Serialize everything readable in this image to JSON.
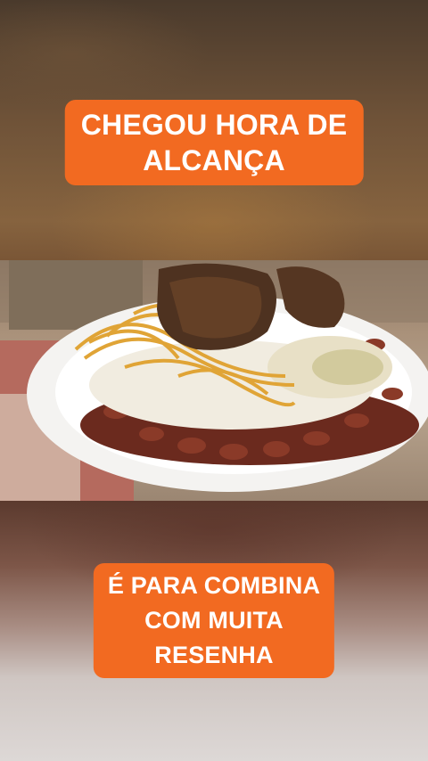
{
  "captions": {
    "top": [
      "CHEGOU HORA DE",
      "ALCANÇA"
    ],
    "bottom": [
      "É PARA COMBINA",
      "COM MUITA",
      "RESENHA"
    ]
  },
  "colors": {
    "caption_bg": "#f26a21",
    "caption_text": "#ffffff"
  }
}
